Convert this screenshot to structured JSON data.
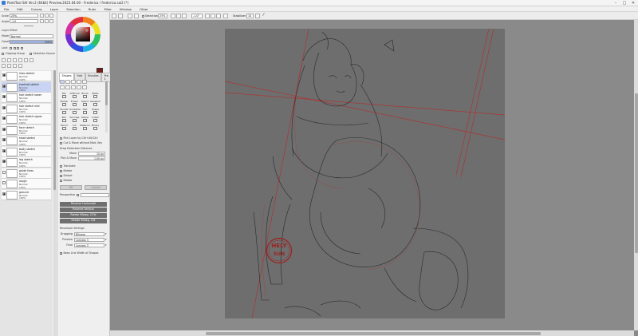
{
  "window": {
    "title": "PaintTool SAI Ver.2 (64bit) Preview.2023.04.00 - Frederica / frederica.sai2 (*)",
    "controls": [
      "–",
      "□",
      "✕"
    ]
  },
  "menu": [
    "File",
    "Edit",
    "Canvas",
    "Layer",
    "Selection",
    "Ruler",
    "Filter",
    "Window",
    "Other"
  ],
  "toolbar": {
    "selection_label": "Selection",
    "zoom": "25%",
    "angle": "-1.0°",
    "stabilizer_label": "Stabilizer",
    "stabilizer_value": "10"
  },
  "left": {
    "scale_label": "Scale",
    "scale_value": "25%",
    "angle_label": "Angle",
    "angle_value": "-1.0",
    "layer_effect": "Layer Effect",
    "mode_label": "Mode",
    "mode_value": "Normal",
    "opacity_label": "Opacity",
    "opacity_value": "100%",
    "lock_label": "Lock",
    "clipping_label": "Clipping Group",
    "selection_source_label": "Selection Source",
    "layers": [
      {
        "name": "lines sketch",
        "mode": "Normal",
        "opacity": "100%",
        "selected": false
      },
      {
        "name": "(sorted) sketch",
        "mode": "Normal",
        "opacity": "100%",
        "selected": true
      },
      {
        "name": "hair sketch lower",
        "mode": "Normal",
        "opacity": "100%",
        "selected": false
      },
      {
        "name": "hair sketch mid",
        "mode": "Normal",
        "opacity": "100%",
        "selected": false
      },
      {
        "name": "hair sketch upper",
        "mode": "Normal",
        "opacity": "100%",
        "selected": false
      },
      {
        "name": "face sketch",
        "mode": "Normal",
        "opacity": "100%",
        "selected": false
      },
      {
        "name": "head sketch",
        "mode": "Normal",
        "opacity": "100%",
        "selected": false
      },
      {
        "name": "body sketch",
        "mode": "Normal",
        "opacity": "100%",
        "selected": false
      },
      {
        "name": "leg sketch",
        "mode": "Normal",
        "opacity": "100%",
        "selected": false
      },
      {
        "name": "guide lines",
        "mode": "Normal",
        "opacity": "100%",
        "selected": false
      },
      {
        "name": "rough",
        "mode": "Normal",
        "opacity": "100%",
        "selected": false
      },
      {
        "name": "ground",
        "mode": "Normal",
        "opacity": "100%",
        "selected": false
      }
    ]
  },
  "mid": {
    "tabs": [
      "Shapes",
      "Fold",
      "Brushes",
      "Pre-1",
      "Preset"
    ],
    "tools": [
      [
        "Pen",
        "AirBrush",
        "Brush",
        "Water"
      ],
      [
        "Marker",
        "Eraser",
        "Select",
        "Deselect"
      ],
      [
        "Bucket",
        "Gradation",
        "Text",
        "Shape"
      ],
      [
        "Blur",
        "Smudge",
        "Stamp",
        "Cutter"
      ],
      [
        "Pencil",
        "Ink",
        "Watercol",
        "Binary"
      ]
    ],
    "pick_layer_label": "Pick Layer by Ctrl+Alt/Ctrl",
    "cut_move_label": "Cut & Move without Mod. Key",
    "drag_distance_label": "Drag Detection Distance",
    "move_label": "Move",
    "move_value": "10 px",
    "pick_move_label": "Pick & Move",
    "pick_move_value": "1.00 px",
    "transform_options": [
      "Translate",
      "Rotate",
      "Distort",
      "Rotate"
    ],
    "ok_label": "OK",
    "cancel_label": "Cancel",
    "perspective_label": "Perspective",
    "reverse_h": "Reverse Horizontal",
    "reverse_v": "Reverse Vertical",
    "rotate_ccw": "Rotate 90deg. CCW",
    "rotate_cw": "Rotate 90deg. CW",
    "resample_label": "Resample Settings",
    "dragging_label": "Dragging",
    "dragging_value": "Bilinear",
    "preview_label": "Preview",
    "preview_value": "Lanczos 3",
    "final_label": "Final",
    "final_value": "Lanczos 3",
    "keep_line_label": "Keep Line Width of Shapes"
  },
  "canvas": {
    "stamp_text_top": "HELY",
    "stamp_text_bottom": "SUN",
    "colors": {
      "gray": "#6e6e6e",
      "line": "#2a2a2a",
      "red": "#b03030"
    }
  }
}
